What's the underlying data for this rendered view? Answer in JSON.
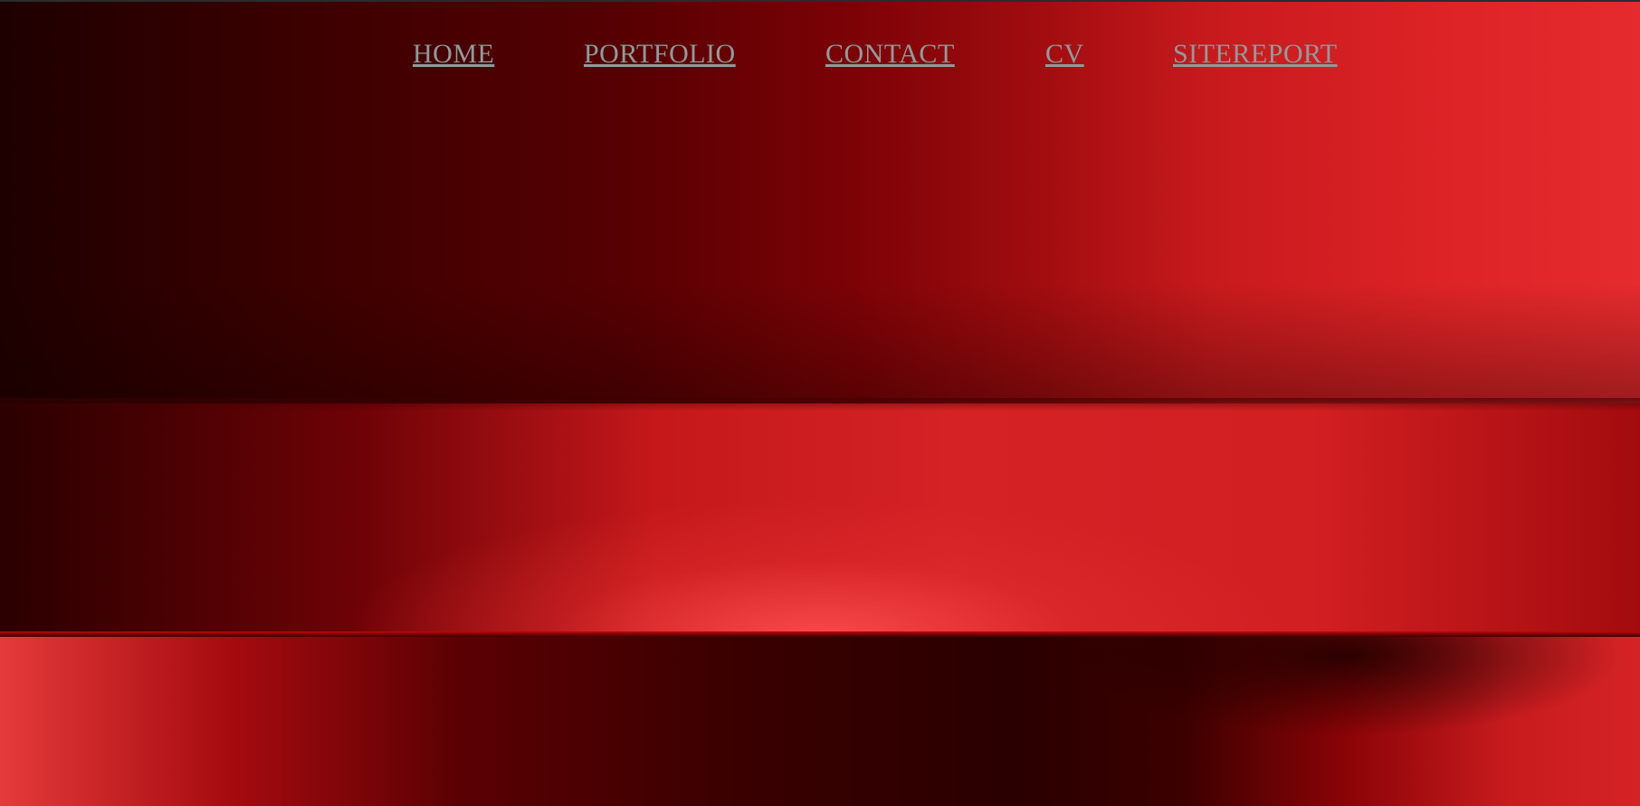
{
  "nav": {
    "items": [
      {
        "label": "HOME"
      },
      {
        "label": "PORTFOLIO"
      },
      {
        "label": "CONTACT"
      },
      {
        "label": "CV"
      },
      {
        "label": "SITEREPORT"
      }
    ]
  },
  "colors": {
    "nav_link": "#8e9c9c",
    "background_dark": "#2a0000",
    "background_red": "#e52b2e"
  }
}
